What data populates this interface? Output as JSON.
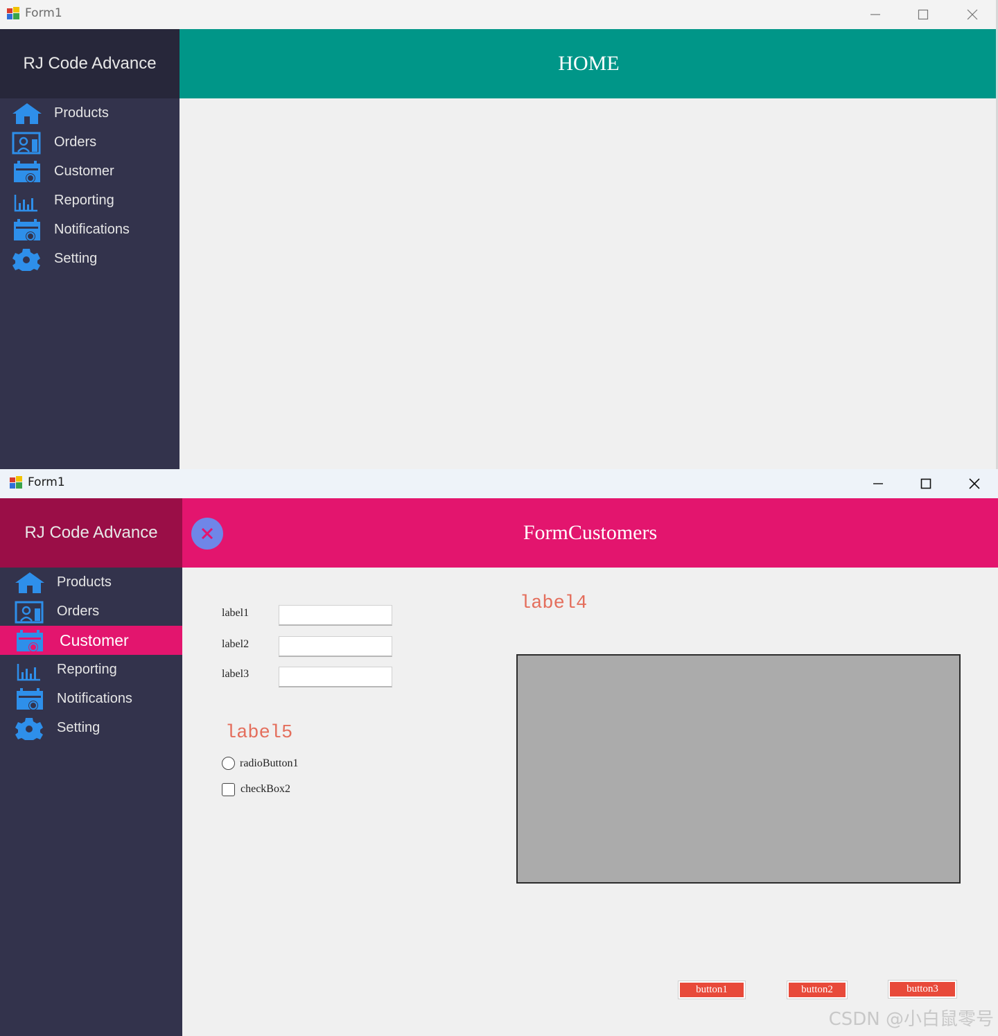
{
  "window_top": {
    "title": "Form1",
    "logo": "RJ Code Advance",
    "header_title": "HOME",
    "menu": [
      {
        "label": "Products",
        "icon": "home-icon"
      },
      {
        "label": "Orders",
        "icon": "orders-icon"
      },
      {
        "label": "Customer",
        "icon": "calendar-icon"
      },
      {
        "label": "Reporting",
        "icon": "bar-chart-icon"
      },
      {
        "label": "Notifications",
        "icon": "calendar-icon"
      },
      {
        "label": "Setting",
        "icon": "gear-icon"
      }
    ]
  },
  "window_bottom": {
    "title": "Form1",
    "logo": "RJ Code Advance",
    "header_title": "FormCustomers",
    "active_menu": "Customer",
    "menu": [
      {
        "label": "Products",
        "icon": "home-icon"
      },
      {
        "label": "Orders",
        "icon": "orders-icon"
      },
      {
        "label": "Customer",
        "icon": "calendar-icon"
      },
      {
        "label": "Reporting",
        "icon": "bar-chart-icon"
      },
      {
        "label": "Notifications",
        "icon": "calendar-icon"
      },
      {
        "label": "Setting",
        "icon": "gear-icon"
      }
    ],
    "form": {
      "label1": "label1",
      "label2": "label2",
      "label3": "label3",
      "textbox1": "",
      "textbox2": "",
      "textbox3": "",
      "label4": "label4",
      "label5": "label5",
      "radio_label": "radioButton1",
      "checkbox_label": "checkBox2",
      "button1": "button1",
      "button2": "button2",
      "button3": "button3"
    }
  },
  "colors": {
    "sidebar": "#33334c",
    "logo_home": "#27273a",
    "logo_customers": "#9a0e47",
    "header_home": "#009688",
    "header_customers": "#e3156e",
    "content_bg": "#f0f0f0",
    "button": "#e84a3a"
  },
  "watermark": "CSDN @小白鼠零号"
}
